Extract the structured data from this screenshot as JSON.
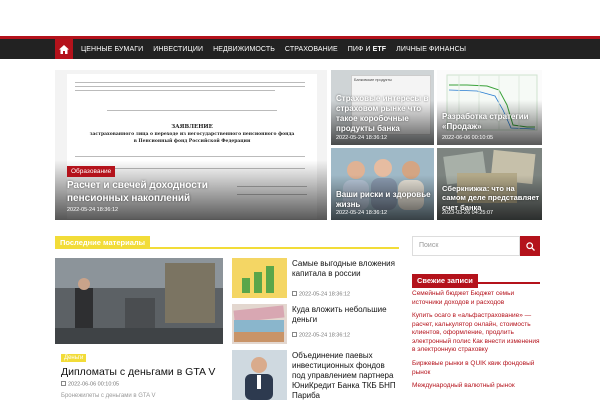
{
  "nav": {
    "items": [
      "ЦЕННЫЕ БУМАГИ",
      "ИНВЕСТИЦИИ",
      "НЕДВИЖИМОСТЬ",
      "СТРАХОВАНИЕ",
      "ПИФ И ",
      "ЛИЧНЫЕ ФИНАНСЫ"
    ],
    "pif_bold": "ETF"
  },
  "hero": {
    "main": {
      "category": "Образование",
      "title": "Расчет и свечей доходности пенсионных накоплений",
      "date": "2022-05-24 18:36:12",
      "doc_title": "ЗАЯВЛЕНИЕ",
      "doc_sub1": "застрахованного лица о переходе из негосударственного пенсионного фонда",
      "doc_sub2": "в Пенсионный фонд Российской Федерации"
    },
    "tile1": {
      "title": "Страховые интересы в страховом рынке что такое коробочные продукты банка",
      "date": "2022-05-24 18:36:12",
      "caption": "Банковские продукты"
    },
    "tile2": {
      "title": "Разработка стратегии «Продаж»",
      "date": "2022-06-06 00:10:05"
    },
    "tile3": {
      "title": "Ваши риски и здоровье жизнь",
      "date": "2022-05-24 18:36:12"
    },
    "tile4": {
      "title": "Сберкнижка: что на самом деле представляет счет банка",
      "date": "2023-03-26 04:25:07"
    }
  },
  "section": {
    "label": "Последние материалы"
  },
  "search": {
    "placeholder": "Поиск"
  },
  "latest": {
    "big": {
      "category": "Деньги",
      "title": "Дипломаты с деньгами в GTA V",
      "date": "2022-06-06 00:10:05",
      "excerpt": "Бронежилеты с деньгами в GTA V"
    },
    "small": [
      {
        "title": "Самые выгодные вложения капитала в россии",
        "date": "2022-05-24 18:36:12"
      },
      {
        "title": "Куда вложить небольшие деньги",
        "date": "2022-05-24 18:36:12"
      },
      {
        "title": "Объединение паевых инвестиционных фондов под управлением партнера ЮниКредит Банка ТКБ БНП Париба",
        "date": ""
      }
    ]
  },
  "sidebar": {
    "heading": "Свежие записи",
    "items": [
      "Семейный бюджет Бюджет семьи источники доходов и расходов",
      "Купить осаго в «альфастрахование» — расчет, калькулятор онлайн, стоимость клиентов, оформление, продлить электронный полис Как внести изменения в электронную страховку",
      "Биржевые рынки в QUIK квик фондовый рынок",
      "Международный валютный рынок"
    ],
    "quik": "QUIK"
  },
  "colors": {
    "accent": "#b4121b",
    "yellow": "#f2dc38",
    "nav_bg": "#222222"
  }
}
